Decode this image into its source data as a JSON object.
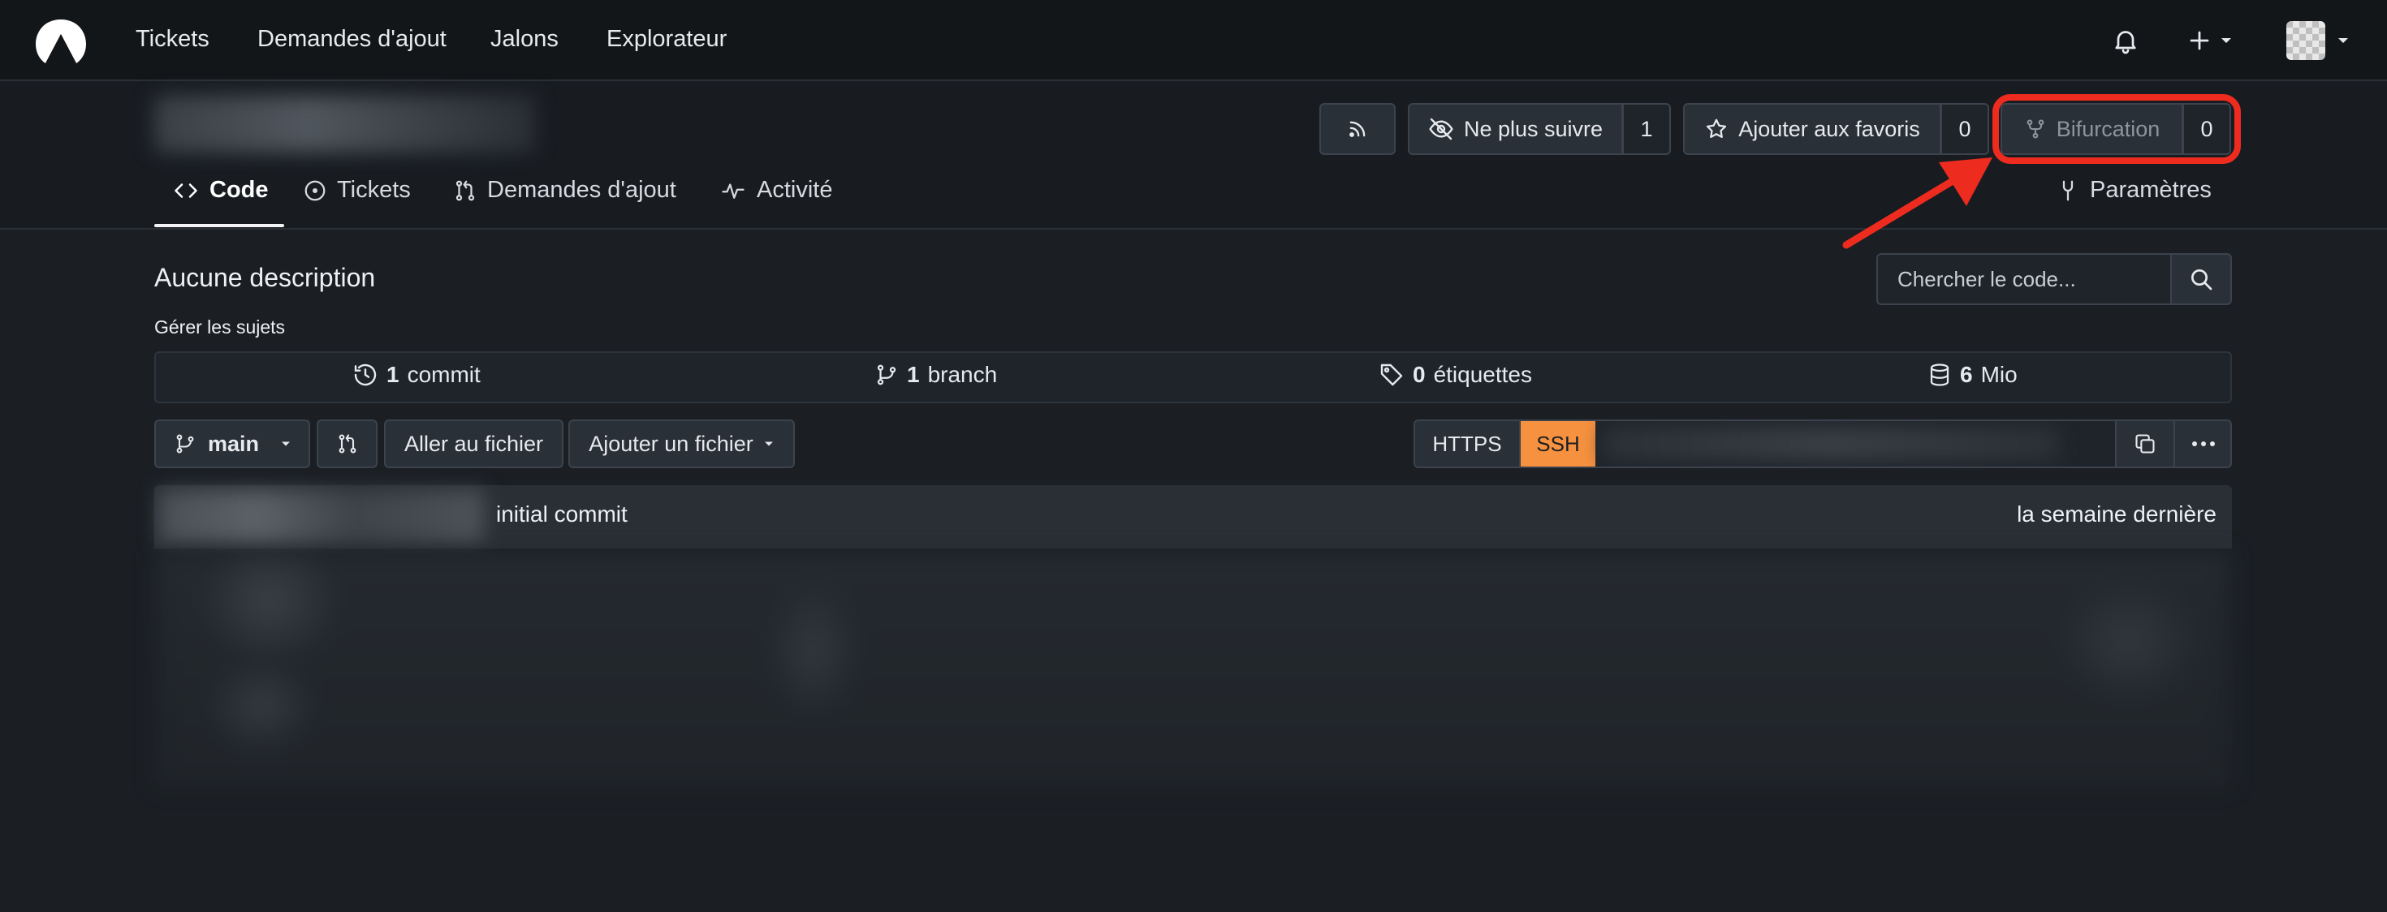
{
  "nav": {
    "links": [
      "Tickets",
      "Demandes d'ajout",
      "Jalons",
      "Explorateur"
    ]
  },
  "repo": {
    "watch_label": "Ne plus suivre",
    "watch_count": "1",
    "star_label": "Ajouter aux favoris",
    "star_count": "0",
    "fork_label": "Bifurcation",
    "fork_count": "0",
    "tabs": {
      "code": "Code",
      "issues": "Tickets",
      "pulls": "Demandes d'ajout",
      "activity": "Activité",
      "settings": "Paramètres"
    }
  },
  "main": {
    "description": "Aucune description",
    "manage_topics": "Gérer les sujets",
    "search_placeholder": "Chercher le code...",
    "stats": {
      "commits_num": "1",
      "commits_label": "commit",
      "branches_num": "1",
      "branches_label": "branch",
      "tags_num": "0",
      "tags_label": "étiquettes",
      "size_num": "6",
      "size_label": "Mio"
    },
    "branch": "main",
    "go_to_file": "Aller au fichier",
    "add_file": "Ajouter un fichier",
    "clone_https": "HTTPS",
    "clone_ssh": "SSH",
    "last_commit_message": "initial commit",
    "last_commit_time": "la semaine dernière"
  },
  "colors": {
    "accent": "#f6913f",
    "highlight": "#ee2b1f",
    "background": "#1b1f24"
  }
}
